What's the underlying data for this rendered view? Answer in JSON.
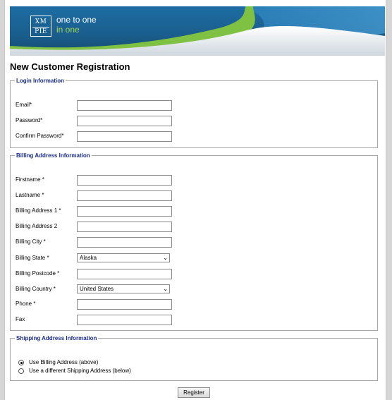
{
  "banner": {
    "logo_top": "XM",
    "logo_bottom": "PIE",
    "tagline_top": "one to one",
    "tagline_bottom": "in one"
  },
  "page_title": "New Customer Registration",
  "login": {
    "legend": "Login Information",
    "fields": [
      {
        "label": "Email*",
        "value": ""
      },
      {
        "label": "Password*",
        "value": ""
      },
      {
        "label": "Confirm Password*",
        "value": ""
      }
    ]
  },
  "billing": {
    "legend": "Billing Address Information",
    "fields": [
      {
        "label": "Firstname *",
        "value": ""
      },
      {
        "label": "Lastname *",
        "value": ""
      },
      {
        "label": "Billing Address 1 *",
        "value": ""
      },
      {
        "label": "Billing Address 2",
        "value": ""
      },
      {
        "label": "Billing City *",
        "value": ""
      },
      {
        "label": "Billing State *",
        "selected": "Alaska"
      },
      {
        "label": "Billing Postcode *",
        "value": ""
      },
      {
        "label": "Billing Country *",
        "selected": "United States"
      },
      {
        "label": "Phone *",
        "value": ""
      },
      {
        "label": "Fax",
        "value": ""
      }
    ]
  },
  "shipping": {
    "legend": "Shipping Address Information",
    "options": [
      {
        "label": "Use Billing Address (above)",
        "checked": true
      },
      {
        "label": "Use a different Shipping Address (below)",
        "checked": false
      }
    ]
  },
  "register_label": "Register",
  "colors": {
    "legend": "#1a2d8c",
    "banner_blue": "#1a5d8c",
    "brand_green": "#a5d84a"
  },
  "icons": {
    "select_arrow": "chevron-down-icon"
  }
}
